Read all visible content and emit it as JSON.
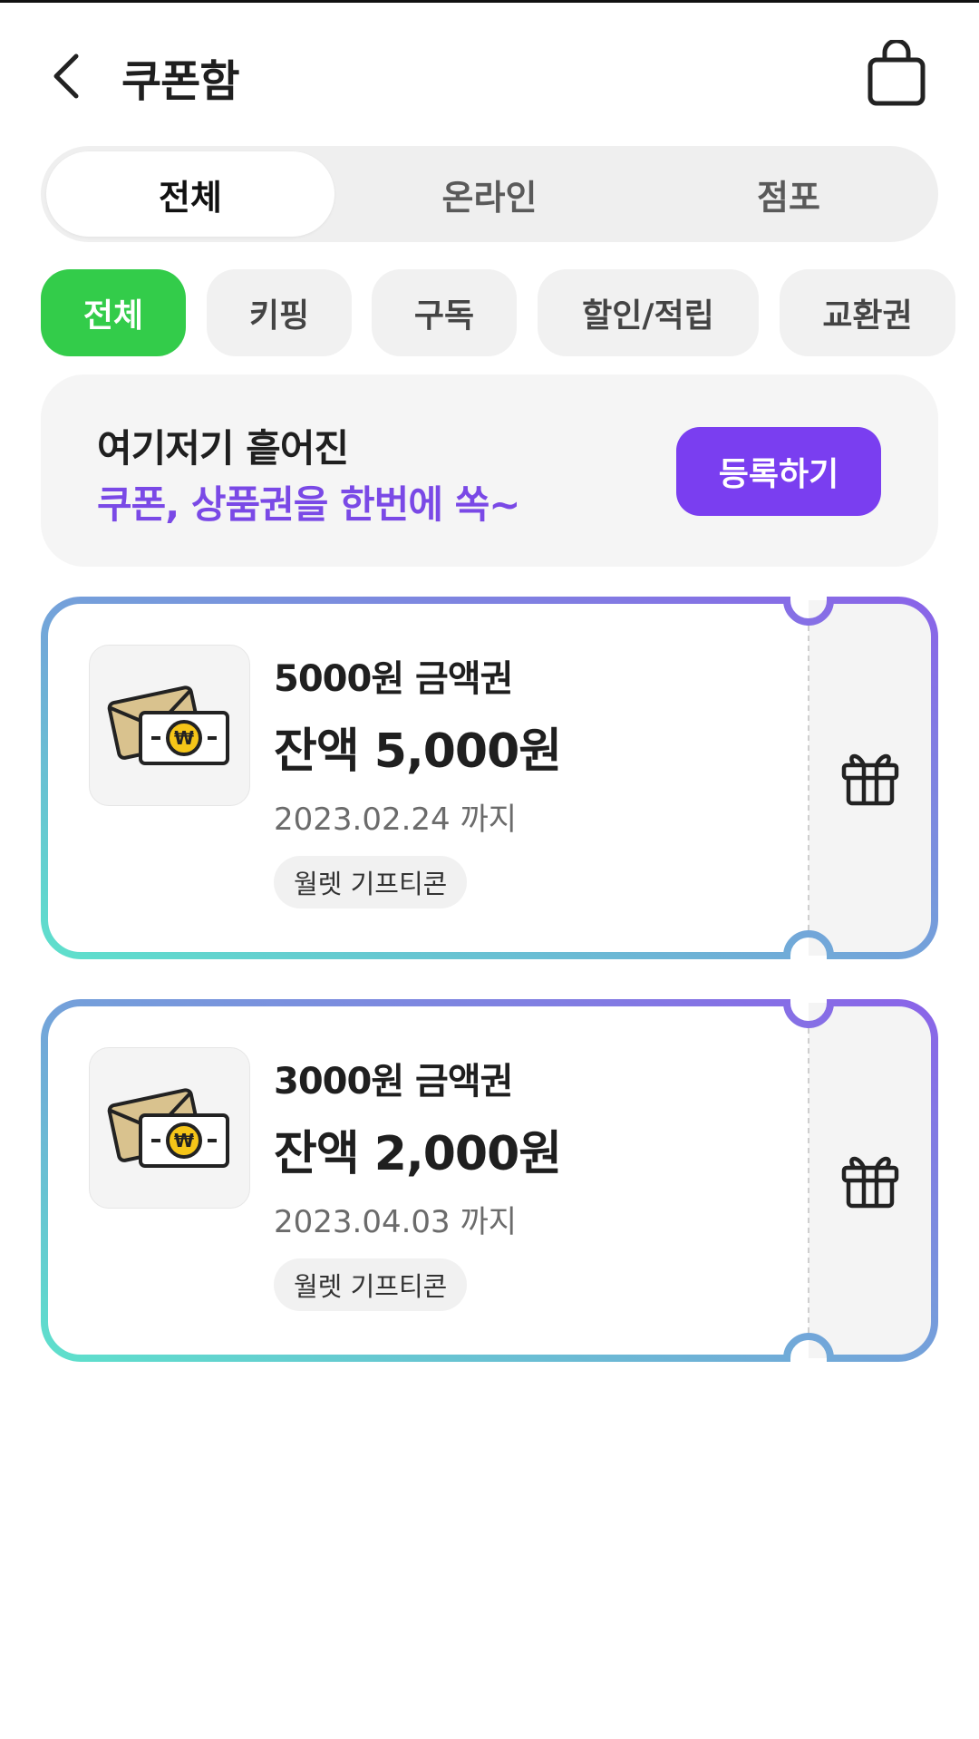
{
  "header": {
    "title": "쿠폰함"
  },
  "segment_tabs": [
    {
      "label": "전체",
      "active": true
    },
    {
      "label": "온라인",
      "active": false
    },
    {
      "label": "점포",
      "active": false
    }
  ],
  "filter_chips": [
    {
      "label": "전체",
      "active": true
    },
    {
      "label": "키핑",
      "active": false
    },
    {
      "label": "구독",
      "active": false
    },
    {
      "label": "할인/적립",
      "active": false
    },
    {
      "label": "교환권",
      "active": false
    }
  ],
  "banner": {
    "line1": "여기저기 흩어진",
    "line2": "쿠폰, 상품권을 한번에 쏙~",
    "button_label": "등록하기"
  },
  "coupons": [
    {
      "name": "5000원 금액권",
      "balance": "잔액 5,000원",
      "expiry": "2023.02.24 까지",
      "tag": "월렛 기프티콘"
    },
    {
      "name": "3000원 금액권",
      "balance": "잔액 2,000원",
      "expiry": "2023.04.03 까지",
      "tag": "월렛 기프티콘"
    }
  ],
  "colors": {
    "chip_active": "#33cc4a",
    "brand_purple": "#7a3ef0",
    "banner_highlight": "#7a49e6",
    "border_gradient_start": "#5ee0cc",
    "border_gradient_end": "#8a63e8"
  },
  "icons": {
    "back": "chevron-left-icon",
    "bag": "shopping-bag-icon",
    "voucher": "envelope-cash-icon",
    "gift": "gift-icon"
  }
}
